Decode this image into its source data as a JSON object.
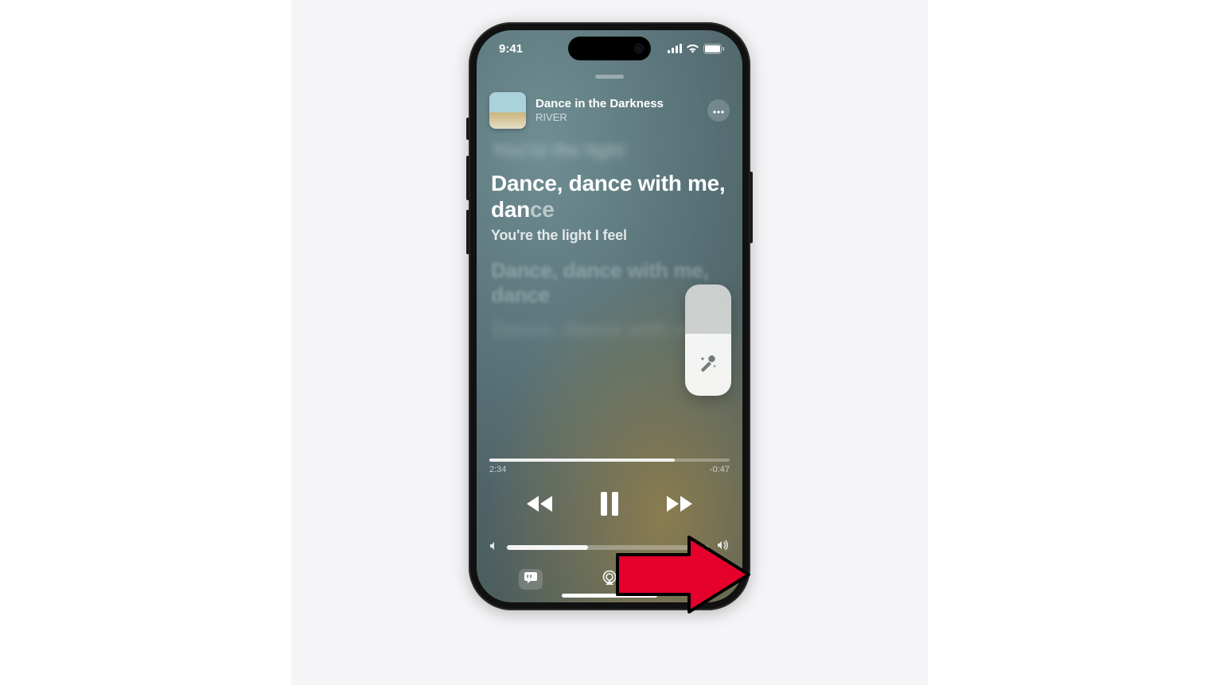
{
  "status": {
    "time": "9:41"
  },
  "now_playing": {
    "title": "Dance in the Darkness",
    "artist": "RIVER"
  },
  "lyrics": {
    "prev_blurred": "You're the light",
    "active_main": "Dance, dance with me, dan",
    "active_tail": "ce",
    "next": "You're the light I feel",
    "fade1": "Dance, dance with me, dance",
    "fade2": "Dance, dance with me"
  },
  "progress": {
    "elapsed": "2:34",
    "remaining": "-0:47",
    "percent": 77
  },
  "volume": {
    "percent": 40
  },
  "sing_slider": {
    "level_percent": 56
  }
}
